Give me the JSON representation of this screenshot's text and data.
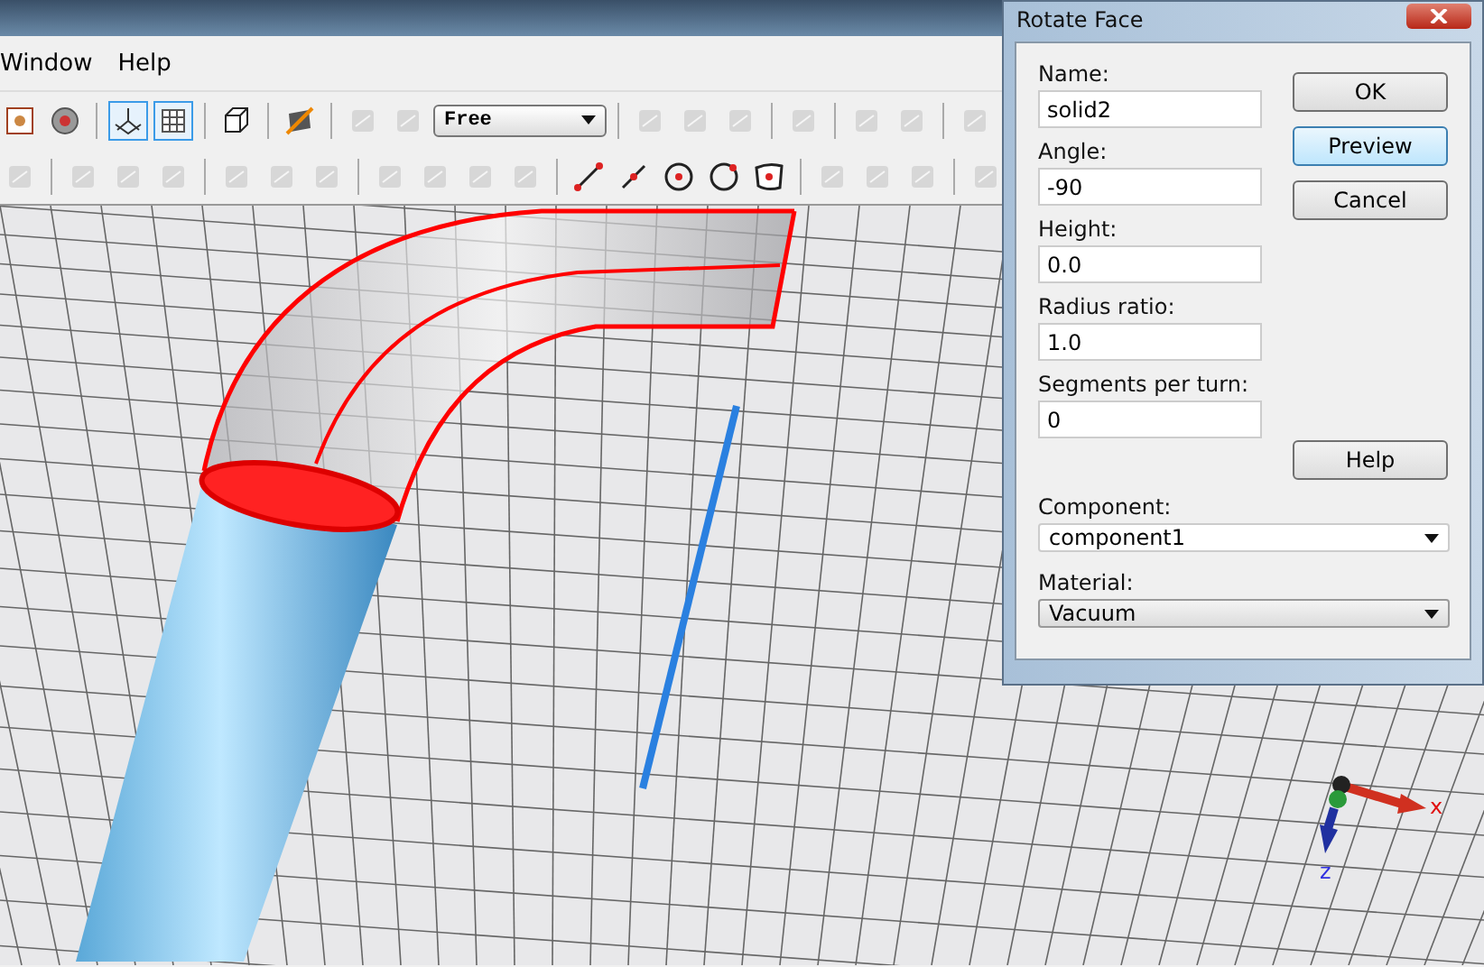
{
  "menu": [
    {
      "label": "Window"
    },
    {
      "label": "Help"
    }
  ],
  "toolbar_rows": [
    [
      {
        "kind": "fit",
        "disabled": false,
        "selected": false
      },
      {
        "kind": "gear",
        "disabled": false,
        "selected": false
      },
      {
        "kind": "sep"
      },
      {
        "kind": "axes",
        "disabled": false,
        "selected": true
      },
      {
        "kind": "grid",
        "disabled": false,
        "selected": true
      },
      {
        "kind": "sep"
      },
      {
        "kind": "cube",
        "disabled": false,
        "selected": false
      },
      {
        "kind": "sep"
      },
      {
        "kind": "plane",
        "disabled": false,
        "selected": false
      },
      {
        "kind": "sep"
      },
      {
        "kind": "generic",
        "disabled": true,
        "selected": false
      },
      {
        "kind": "generic",
        "disabled": true,
        "selected": false
      },
      {
        "kind": "dropdown",
        "value": "Free"
      },
      {
        "kind": "sep"
      },
      {
        "kind": "generic",
        "disabled": true,
        "selected": false
      },
      {
        "kind": "generic",
        "disabled": true,
        "selected": false
      },
      {
        "kind": "generic",
        "disabled": true,
        "selected": false
      },
      {
        "kind": "sep"
      },
      {
        "kind": "generic",
        "disabled": true,
        "selected": false
      },
      {
        "kind": "sep"
      },
      {
        "kind": "generic",
        "disabled": true,
        "selected": false
      },
      {
        "kind": "generic",
        "disabled": true,
        "selected": false
      },
      {
        "kind": "sep"
      },
      {
        "kind": "generic",
        "disabled": true,
        "selected": false
      }
    ],
    [
      {
        "kind": "generic",
        "disabled": true,
        "selected": false
      },
      {
        "kind": "sep"
      },
      {
        "kind": "generic",
        "disabled": true,
        "selected": false
      },
      {
        "kind": "generic",
        "disabled": true,
        "selected": false
      },
      {
        "kind": "generic",
        "disabled": true,
        "selected": false
      },
      {
        "kind": "sep"
      },
      {
        "kind": "generic",
        "disabled": true,
        "selected": false
      },
      {
        "kind": "generic",
        "disabled": true,
        "selected": false
      },
      {
        "kind": "generic",
        "disabled": true,
        "selected": false
      },
      {
        "kind": "sep"
      },
      {
        "kind": "generic",
        "disabled": true,
        "selected": false
      },
      {
        "kind": "generic",
        "disabled": true,
        "selected": false
      },
      {
        "kind": "generic",
        "disabled": true,
        "selected": false
      },
      {
        "kind": "generic",
        "disabled": true,
        "selected": false
      },
      {
        "kind": "sep"
      },
      {
        "kind": "line",
        "disabled": false,
        "selected": false
      },
      {
        "kind": "midline",
        "disabled": false,
        "selected": false
      },
      {
        "kind": "circle",
        "disabled": false,
        "selected": false
      },
      {
        "kind": "arc",
        "disabled": false,
        "selected": false
      },
      {
        "kind": "face",
        "disabled": false,
        "selected": false
      },
      {
        "kind": "sep"
      },
      {
        "kind": "generic",
        "disabled": true,
        "selected": false
      },
      {
        "kind": "generic",
        "disabled": true,
        "selected": false
      },
      {
        "kind": "generic",
        "disabled": true,
        "selected": false
      },
      {
        "kind": "sep"
      },
      {
        "kind": "generic",
        "disabled": true,
        "selected": false
      }
    ]
  ],
  "viewport": {
    "axes": [
      {
        "label": "x",
        "color": "#e01010"
      },
      {
        "label": "z",
        "color": "#3030e0"
      }
    ]
  },
  "dialog": {
    "title": "Rotate Face",
    "fields": [
      {
        "label": "Name:",
        "value": "solid2"
      },
      {
        "label": "Angle:",
        "value": "-90"
      },
      {
        "label": "Height:",
        "value": "0.0"
      },
      {
        "label": "Radius ratio:",
        "value": "1.0"
      },
      {
        "label": "Segments per turn:",
        "value": "0"
      }
    ],
    "dropdowns": [
      {
        "label": "Component:",
        "value": "component1",
        "editable": true
      },
      {
        "label": "Material:",
        "value": "Vacuum",
        "editable": false
      }
    ],
    "buttons": [
      {
        "label": "OK",
        "focused": false
      },
      {
        "label": "Preview",
        "focused": true
      },
      {
        "label": "Cancel",
        "focused": false
      },
      {
        "label": "Help",
        "focused": false
      }
    ]
  }
}
